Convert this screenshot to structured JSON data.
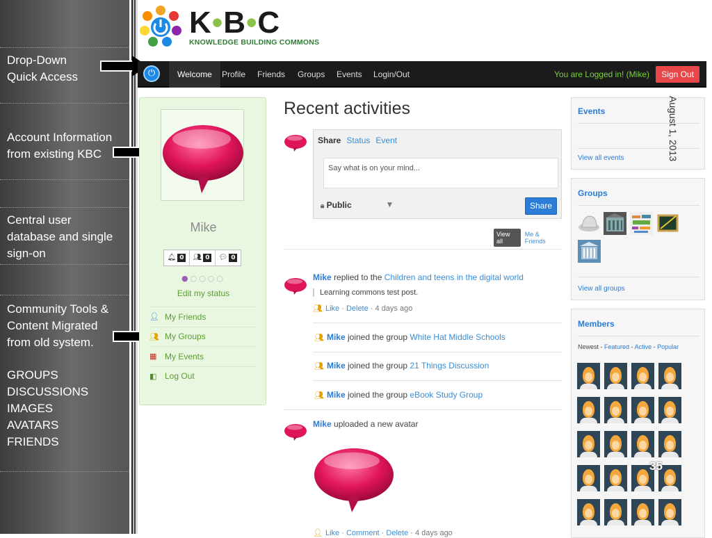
{
  "annotations": {
    "quick_access": [
      "Drop-Down",
      "Quick Access"
    ],
    "account_info": [
      "Account Information",
      "from existing KBC"
    ],
    "central_db": [
      "Central user",
      "database and single",
      "sign-on"
    ],
    "community_tools": [
      "Community Tools &",
      "Content Migrated",
      "from old system."
    ],
    "migrated_items": [
      "GROUPS",
      "DISCUSSIONS",
      "IMAGES",
      "AVATARS",
      "FRIENDS"
    ]
  },
  "logo": {
    "letters": [
      "K",
      "B",
      "C"
    ],
    "subtitle": "KNOWLEDGE BUILDING COMMONS"
  },
  "nav": {
    "items": [
      "Welcome",
      "Profile",
      "Friends",
      "Groups",
      "Events",
      "Login/Out"
    ],
    "status": "You are Logged in! (Mike)",
    "signout": "Sign Out"
  },
  "profile": {
    "name": "Mike",
    "counters": [
      "0",
      "0",
      "0"
    ],
    "edit_status": "Edit my status",
    "menu": [
      "My Friends",
      "My Groups",
      "My Events",
      "Log Out"
    ]
  },
  "activity": {
    "title": "Recent activities",
    "share": {
      "tab_share": "Share",
      "tab_status": "Status",
      "tab_event": "Event",
      "placeholder": "Say what is on your mind...",
      "privacy": "Public",
      "button": "Share"
    },
    "filters": {
      "view_all": "View all",
      "me_friends": "Me & Friends"
    },
    "items": [
      {
        "user": "Mike",
        "text": " replied to the ",
        "link": "Children and teens in the digital world",
        "quote": "Learning commons test post.",
        "like": "Like",
        "delete": "Delete",
        "age": "4 days ago"
      },
      {
        "user": "Mike",
        "text": " joined the group ",
        "link": "White Hat Middle Schools"
      },
      {
        "user": "Mike",
        "text": " joined the group ",
        "link": "21 Things Discussion"
      },
      {
        "user": "Mike",
        "text": " joined the group ",
        "link": "eBook Study Group"
      },
      {
        "user": "Mike",
        "text": " uploaded a new avatar",
        "like": "Like",
        "comment": "Comment",
        "delete": "Delete",
        "age": "4 days ago"
      }
    ]
  },
  "sidebar": {
    "events": {
      "title": "Events",
      "link": "View all events"
    },
    "groups": {
      "title": "Groups",
      "link": "View all groups"
    },
    "members": {
      "title": "Members",
      "newest": "Newest",
      "featured": "Featured",
      "active": "Active",
      "popular": "Popular"
    }
  },
  "slide": {
    "date": "August 1, 2013",
    "page": "35"
  },
  "colors": {
    "accent": "#2a7cd6",
    "signout": "#e8474a",
    "logged": "#7cd13f",
    "profile_bg": "#e9f7e1"
  }
}
